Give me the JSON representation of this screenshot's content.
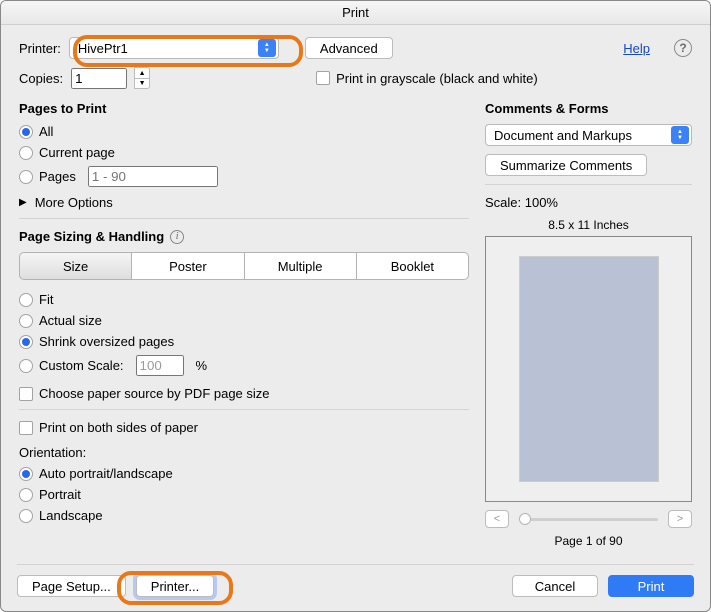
{
  "window": {
    "title": "Print"
  },
  "header": {
    "printer_label": "Printer:",
    "printer_value": "HivePtr1",
    "advanced": "Advanced",
    "help": "Help",
    "copies_label": "Copies:",
    "copies_value": "1",
    "grayscale": "Print in grayscale (black and white)"
  },
  "pages": {
    "title": "Pages to Print",
    "all": "All",
    "current": "Current page",
    "pages": "Pages",
    "pages_placeholder": "1 - 90",
    "more": "More Options"
  },
  "sizing": {
    "title": "Page Sizing & Handling",
    "tabs": {
      "size": "Size",
      "poster": "Poster",
      "multiple": "Multiple",
      "booklet": "Booklet"
    },
    "fit": "Fit",
    "actual": "Actual size",
    "shrink": "Shrink oversized pages",
    "custom": "Custom Scale:",
    "custom_value": "100",
    "percent": "%",
    "paper_source": "Choose paper source by PDF page size",
    "both_sides": "Print on both sides of paper"
  },
  "orientation": {
    "title": "Orientation:",
    "auto": "Auto portrait/landscape",
    "portrait": "Portrait",
    "landscape": "Landscape"
  },
  "comments": {
    "title": "Comments & Forms",
    "value": "Document and Markups",
    "summarize": "Summarize Comments"
  },
  "preview": {
    "scale": "Scale: 100%",
    "sheet": "8.5 x 11 Inches",
    "page": "Page 1 of 90"
  },
  "footer": {
    "page_setup": "Page Setup...",
    "printer": "Printer...",
    "cancel": "Cancel",
    "print": "Print"
  }
}
